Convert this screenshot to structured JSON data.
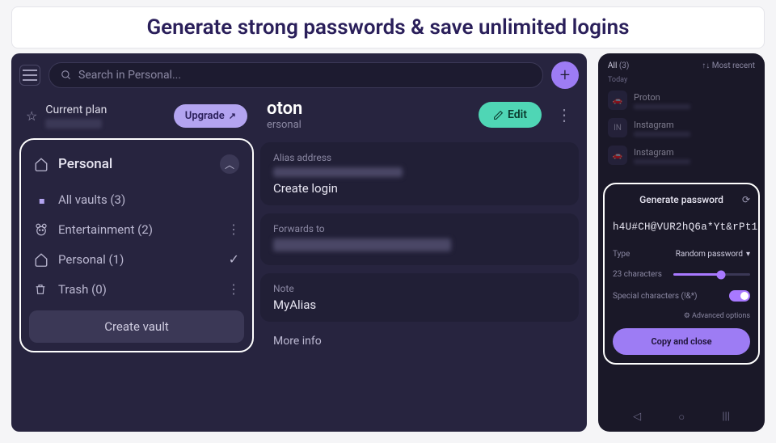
{
  "banner": "Generate strong passwords & save unlimited logins",
  "desktop": {
    "search_placeholder": "Search in Personal...",
    "plan": {
      "label": "Current plan",
      "upgrade": "Upgrade"
    },
    "vault": {
      "title": "Personal",
      "items": [
        {
          "icon": "diamond",
          "name": "All vaults",
          "count": "(3)",
          "action": "dots"
        },
        {
          "icon": "bear",
          "name": "Entertainment",
          "count": "(2)",
          "action": "dots"
        },
        {
          "icon": "home",
          "name": "Personal",
          "count": "(1)",
          "action": "check"
        },
        {
          "icon": "trash",
          "name": "Trash",
          "count": "(0)",
          "action": "dots"
        }
      ],
      "create": "Create vault"
    },
    "detail": {
      "title_suffix": "oton",
      "subtitle_suffix": "ersonal",
      "edit": "Edit",
      "alias_label": "Alias address",
      "create_login": "Create login",
      "forwards_label": "Forwards to",
      "note_label": "Note",
      "note_value": "MyAlias",
      "more_info": "More info"
    }
  },
  "mobile": {
    "tab_all": "All",
    "tab_count": "(3)",
    "sort": "Most recent",
    "section": "Today",
    "items": [
      {
        "badge": "🚗",
        "name": "Proton"
      },
      {
        "badge": "IN",
        "name": "Instagram"
      },
      {
        "badge": "🚗",
        "name": "Instagram"
      }
    ],
    "gen": {
      "title": "Generate password",
      "password": "h4U#CH@VUR2hQ6a*Yt&rPt1",
      "type_label": "Type",
      "type_value": "Random password",
      "length_label": "23 characters",
      "special_label": "Special characters (!&*)",
      "advanced": "⚙ Advanced options",
      "copy": "Copy and close"
    }
  }
}
